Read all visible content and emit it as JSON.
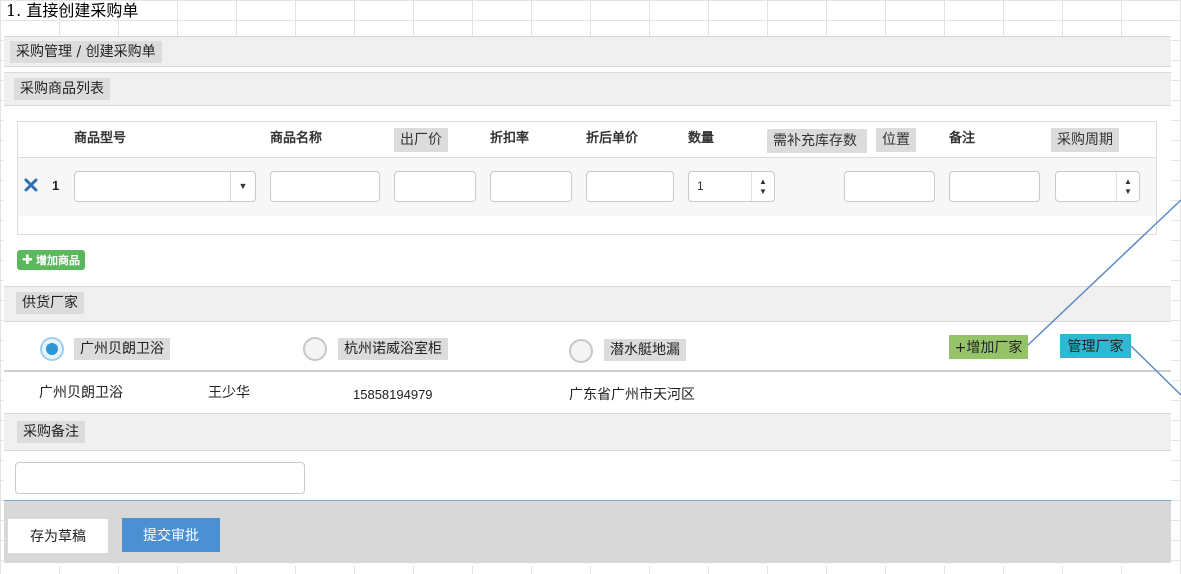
{
  "page": {
    "heading": "1. 直接创建采购单"
  },
  "breadcrumb": {
    "text": "采购管理 / 创建采购单"
  },
  "product_section": {
    "title": "采购商品列表",
    "columns": {
      "model": "商品型号",
      "name": "商品名称",
      "factory_price": "出厂价",
      "discount_rate": "折扣率",
      "discounted_price": "折后单价",
      "quantity": "数量",
      "restock": "需补充库存数",
      "location": "位置",
      "note": "备注",
      "period": "采购周期"
    },
    "rows": [
      {
        "index": "1",
        "model": "",
        "name": "",
        "factory_price": "",
        "discount_rate": "",
        "discounted_price": "",
        "quantity": "1",
        "location": "",
        "note": "",
        "period": ""
      }
    ],
    "add_button": "增加商品"
  },
  "vendor_section": {
    "title": "供货厂家",
    "options": [
      {
        "label": "广州贝朗卫浴",
        "checked": true
      },
      {
        "label": "杭州诺威浴室柜",
        "checked": false
      },
      {
        "label": "潜水艇地漏",
        "checked": false
      }
    ],
    "add_button": "+增加厂家",
    "manage_button": "管理厂家",
    "selected_info": {
      "company": "广州贝朗卫浴",
      "contact": "王少华",
      "phone": "15858194979",
      "address": "广东省广州市天河区"
    }
  },
  "remark_section": {
    "title": "采购备注",
    "value": ""
  },
  "footer": {
    "draft_button": "存为草稿",
    "submit_button": "提交审批"
  },
  "colors": {
    "primary_blue": "#4a90d3",
    "add_green": "#5cb85c",
    "vendor_add_green": "#94c467",
    "vendor_manage_cyan": "#2fb7d4",
    "radio_checked": "#2d96d3",
    "delete_x": "#2d6fb0"
  },
  "icons": {
    "delete": "close-icon",
    "add": "plus-icon",
    "select": "chevron-down-icon",
    "spinner": "spinner-arrows-icon"
  }
}
